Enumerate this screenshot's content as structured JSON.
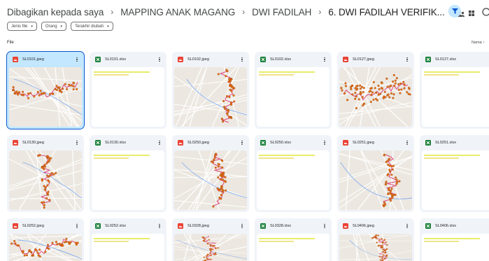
{
  "breadcrumb": {
    "items": [
      "Dibagikan kepada saya",
      "MAPPING ANAK MAGANG",
      "DWI FADILAH",
      "6. DWI FADILAH VERIFIK..."
    ],
    "separator": "›",
    "dropdown_glyph": "▾",
    "share_icon": "people-icon"
  },
  "toolbar": {
    "filter_icon": "filter-icon",
    "view_icon": "grid-view-icon",
    "info_icon": "info-icon",
    "accent": "#c2e7ff"
  },
  "filters": [
    {
      "label": "Jenis file",
      "caret": "▾"
    },
    {
      "label": "Orang",
      "caret": "▾"
    },
    {
      "label": "Terakhir diubah",
      "caret": "▾"
    }
  ],
  "section": {
    "label": "File",
    "sort": "Nama ↑"
  },
  "files": [
    {
      "name": "SL0101.jpeg",
      "type": "image",
      "selected": true
    },
    {
      "name": "SL0101.xlsx",
      "type": "sheet"
    },
    {
      "name": "SL0102.jpeg",
      "type": "image"
    },
    {
      "name": "SL0102.xlsx",
      "type": "sheet"
    },
    {
      "name": "SL0127.jpeg",
      "type": "image"
    },
    {
      "name": "SL0127.xlsx",
      "type": "sheet"
    },
    {
      "name": "SL0130.jpeg",
      "type": "image"
    },
    {
      "name": "SL0130.xlsx",
      "type": "sheet"
    },
    {
      "name": "SL0250.jpeg",
      "type": "image"
    },
    {
      "name": "SL0250.xlsx",
      "type": "sheet"
    },
    {
      "name": "SL0251.jpeg",
      "type": "image"
    },
    {
      "name": "SL0251.xlsx",
      "type": "sheet"
    },
    {
      "name": "SL0252.jpeg",
      "type": "image"
    },
    {
      "name": "SL0252.xlsx",
      "type": "sheet"
    },
    {
      "name": "SL0328.jpeg",
      "type": "image"
    },
    {
      "name": "SL0328.xlsx",
      "type": "sheet"
    },
    {
      "name": "SL0406.jpeg",
      "type": "image"
    },
    {
      "name": "SL0406.xlsx",
      "type": "sheet"
    }
  ],
  "colors": {
    "image_file": "#ea4335",
    "sheet_file": "#188038",
    "map_point": "#e8711a",
    "map_route": "#d81b60",
    "map_road": "#4285f4",
    "selected_border": "#0b57d0"
  }
}
